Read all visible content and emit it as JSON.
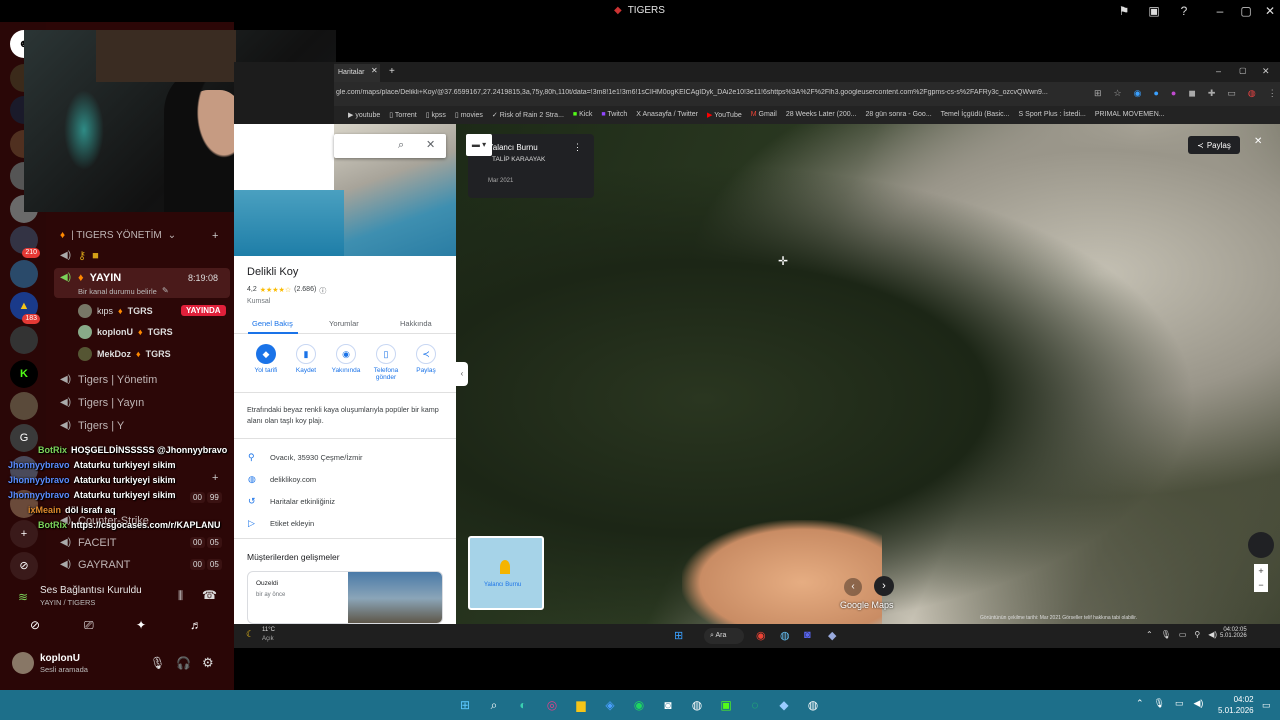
{
  "window": {
    "title": "TIGERS"
  },
  "discord": {
    "category": "| TIGERS YÖNETİM",
    "live_channel": {
      "name": "YAYIN",
      "time": "8:19:08",
      "status_placeholder": "Bir kanal durumu belirle"
    },
    "voice_users": [
      {
        "name": "kιps",
        "tag": "TGRS",
        "live": "YAYINDA"
      },
      {
        "name": "koplonU",
        "tag": "TGRS"
      },
      {
        "name": "MekDoz",
        "tag": "TGRS"
      }
    ],
    "channels": [
      {
        "name": "Tigers | Yönetim"
      },
      {
        "name": "Tigers | Yayın"
      },
      {
        "name": "Tigers | Y"
      },
      {
        "name": "Counter-Strike",
        "count_a": "00",
        "count_b": "99"
      },
      {
        "name": "FACEIT",
        "count_a": "00",
        "count_b": "05"
      },
      {
        "name": "GAYRANT",
        "count_a": "00",
        "count_b": "05"
      }
    ],
    "server_badges": [
      "210",
      "183"
    ],
    "voice_status": {
      "title": "Ses Bağlantısı Kuruldu",
      "sub": "YAYIN / TIGERS"
    },
    "account": {
      "name": "koplonU",
      "status": "Sesli aramada"
    }
  },
  "chat": [
    {
      "user": "BotRix",
      "msg": "HOŞGELDİNSSSSS @Jhonnyybravo",
      "color": "#7cd35a"
    },
    {
      "user": "Jhonnyybravo",
      "msg": "Ataturku turkiyeyi sikim",
      "color": "#5b8cff"
    },
    {
      "user": "Jhonnyybravo",
      "msg": "Ataturku turkiyeyi sikim",
      "color": "#5b8cff"
    },
    {
      "user": "Jhonnyybravo",
      "msg": "Ataturku turkiyeyi sikim",
      "color": "#5b8cff"
    },
    {
      "user": "ixMeain",
      "msg": "döl israfı aq",
      "color": "#e08a2c"
    },
    {
      "user": "BotRix",
      "msg": "https://csgocases.com/r/KAPLANU",
      "color": "#7cd35a"
    }
  ],
  "browser": {
    "tab": "Haritalar",
    "url": "gle.com/maps/place/Delikli+Koy/@37.6599167,27.2419815,3a,75y,80h,110t/data=!3m8!1e1!3m6!1sCIHM0ogKEICAgIDyk_DAi2e10!3e11!6shttps%3A%2F%2Flh3.googleusercontent.com%2Fgpms-cs-s%2FAFRy3c_ozcvQWwn9...",
    "bookmarks": [
      "youtube",
      "Torrent",
      "kpss",
      "movies",
      "Risk of Rain 2 Stra...",
      "Kick",
      "Twitch",
      "Anasayfa / Twitter",
      "YouTube",
      "Gmail",
      "28 Weeks Later (200...",
      "28 gün sonra - Goo...",
      "Temel İçgüdü (Basic...",
      "S Sport Plus : İstedi...",
      "PRIMAL MOVEMEN..."
    ]
  },
  "maps": {
    "place": "Delikli Koy",
    "rating": "4,2",
    "stars": "★★★★☆",
    "reviews": "(2.686)",
    "category": "Kumsal",
    "tabs": [
      "Genel Bakış",
      "Yorumlar",
      "Hakkında"
    ],
    "actions": [
      "Yol tarifi",
      "Kaydet",
      "Yakınında",
      "Telefona gönder",
      "Paylaş"
    ],
    "description": "Etrafındaki beyaz renkli kaya oluşumlarıyla popüler bir kamp alanı olan taşlı koy plajı.",
    "address": "Ovacık, 35930 Çeşme/İzmir",
    "website": "deliklikoy.com",
    "activity": "Haritalar etkinliğiniz",
    "label": "Etiket ekleyin",
    "highlights": "Müşterilerden gelişmeler",
    "post_author": "Ouzeldi",
    "post_time": "bir ay önce",
    "sv_title": "Yalancı Burnu",
    "sv_author": "TALİP KARAAYAK",
    "sv_date": "Mar 2021",
    "share": "Paylaş",
    "logo": "Google Maps",
    "minimap_label": "Yalancı Burnu",
    "footer": "Görüntünün çekilme tarihi: Mar 2021   Görseller telif hakkına tabi olabilir."
  },
  "inner_taskbar": {
    "weather_temp": "11°C",
    "weather_desc": "Açık",
    "search": "Ara",
    "time": "04:02:05",
    "date": "5.01.2026"
  },
  "taskbar": {
    "time": "04:02",
    "date": "5.01.2026"
  }
}
